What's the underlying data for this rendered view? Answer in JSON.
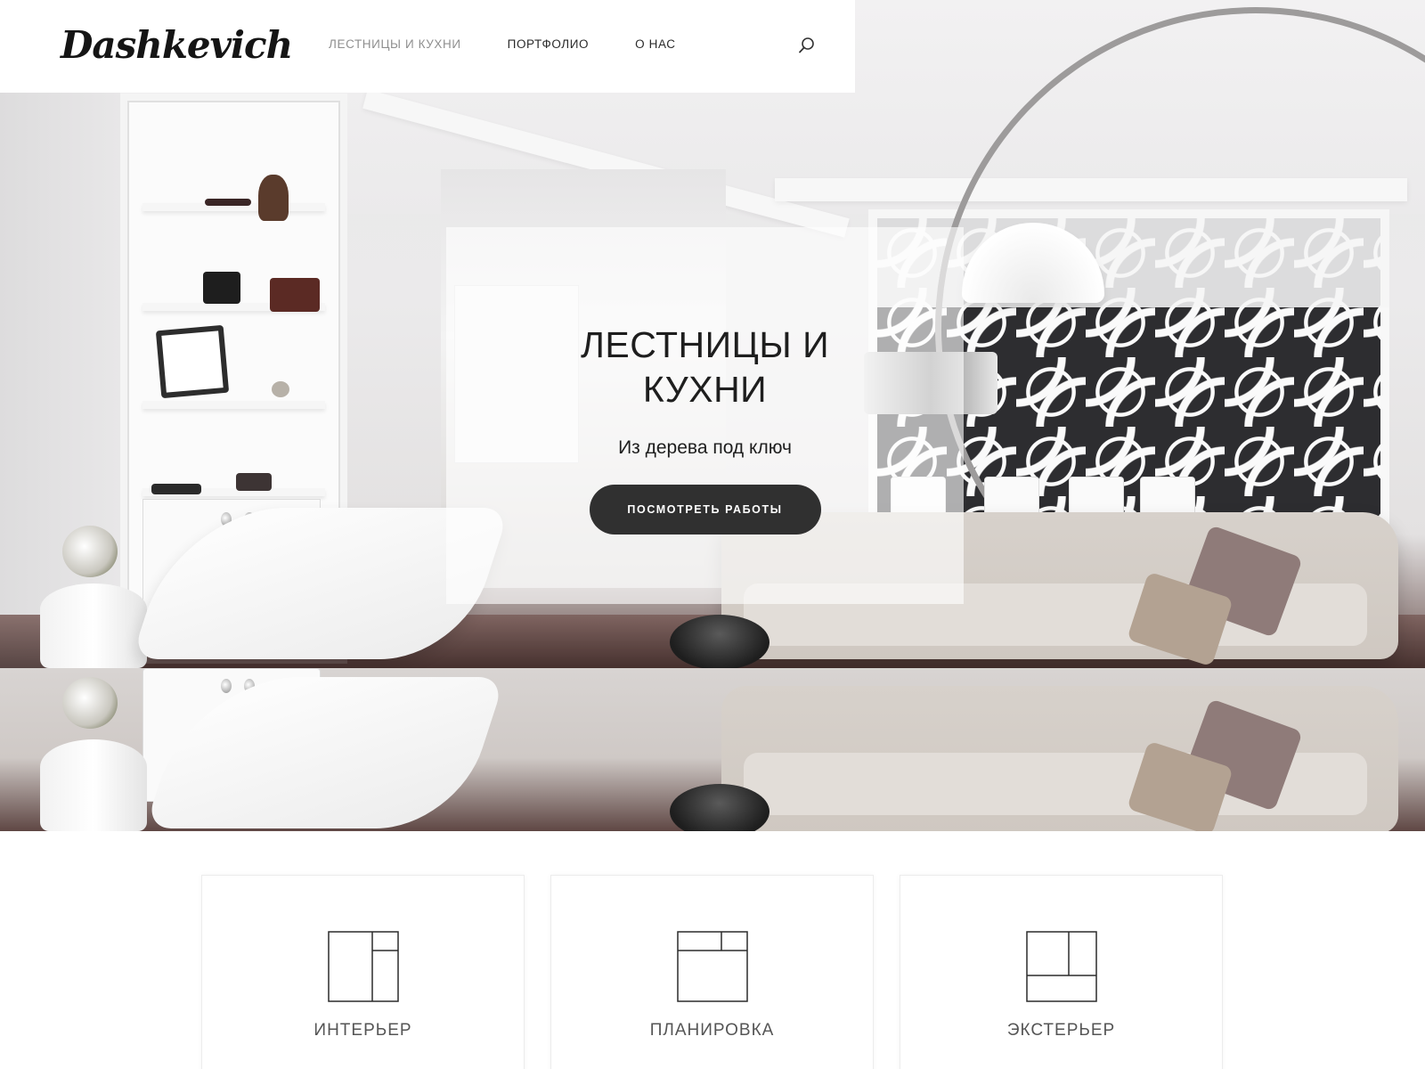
{
  "header": {
    "logo": "Dashkevich",
    "nav": [
      {
        "label": "Лестницы и кухни",
        "active": true
      },
      {
        "label": "Портфолио",
        "active": false
      },
      {
        "label": "О нас",
        "active": false
      }
    ],
    "search_icon": "search-icon"
  },
  "hero": {
    "title": "ЛЕСТНИЦЫ И КУХНИ",
    "subtitle": "Из дерева под ключ",
    "cta_label": "Посмотреть работы"
  },
  "features": [
    {
      "title": "Интерьер",
      "icon": "layout-interior-icon",
      "desc": ""
    },
    {
      "title": "Планировка",
      "icon": "layout-planning-icon",
      "desc": ""
    },
    {
      "title": "Экстерьер",
      "icon": "layout-exterior-icon",
      "desc": ""
    }
  ],
  "colors": {
    "accent_dark": "#303030",
    "nav_active": "#8f8f8f",
    "text": "#2b2b2b"
  }
}
